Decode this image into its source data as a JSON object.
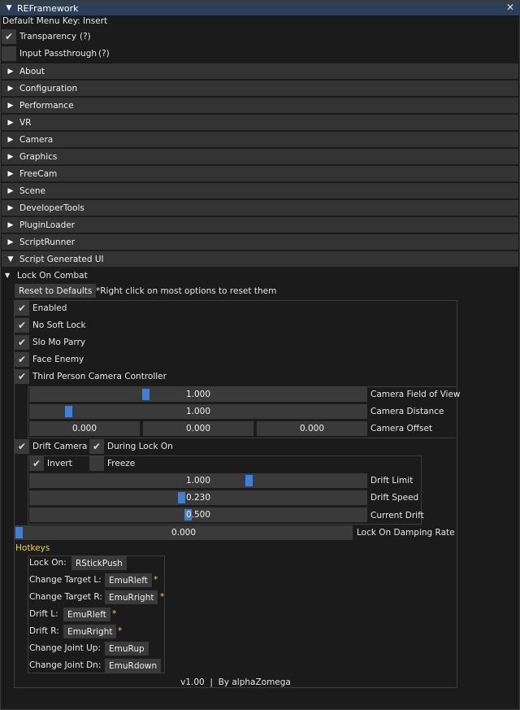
{
  "window": {
    "title": "REFramework"
  },
  "menu_key_text": "Default Menu Key: Insert",
  "options": {
    "transparency": {
      "label": "Transparency",
      "help": "(?)",
      "checked": true
    },
    "input_passthrough": {
      "label": "Input Passthrough",
      "help": "(?)",
      "checked": false
    }
  },
  "sections": [
    "About",
    "Configuration",
    "Performance",
    "VR",
    "Camera",
    "Graphics",
    "FreeCam",
    "Scene",
    "DeveloperTools",
    "PluginLoader",
    "ScriptRunner"
  ],
  "script_ui": {
    "header": "Script Generated UI",
    "lock_on_combat": {
      "title": "Lock On Combat",
      "reset_button": "Reset to Defaults",
      "reset_note": "*Right click on most options to reset them",
      "checkboxes": [
        {
          "label": "Enabled",
          "checked": true
        },
        {
          "label": "No Soft Lock",
          "checked": true
        },
        {
          "label": "Slo Mo Parry",
          "checked": true
        },
        {
          "label": "Face Enemy",
          "checked": true
        },
        {
          "label": "Third Person Camera Controller",
          "checked": true
        }
      ],
      "camera_fov": {
        "label": "Camera Field of View",
        "value": "1.000",
        "fraction": 0.34
      },
      "camera_distance": {
        "label": "Camera Distance",
        "value": "1.000",
        "fraction": 0.105
      },
      "camera_offset": {
        "label": "Camera Offset",
        "values": [
          "0.000",
          "0.000",
          "0.000"
        ]
      },
      "drift_camera": {
        "label": "Drift Camera",
        "checked": true
      },
      "during_lock_on": {
        "label": "During Lock On",
        "checked": true
      },
      "drift": {
        "invert": {
          "label": "Invert",
          "checked": true
        },
        "freeze": {
          "label": "Freeze",
          "checked": false
        },
        "limit": {
          "label": "Drift Limit",
          "value": "1.000",
          "fraction": 0.655
        },
        "speed": {
          "label": "Drift Speed",
          "value": "0.230",
          "fraction": 0.45
        },
        "current": {
          "label": "Current Drift",
          "value": "0.500",
          "fraction": 0.47
        }
      },
      "damping": {
        "label": "Lock On Damping Rate",
        "value": "0.000",
        "fraction": 0.0
      },
      "hotkeys": {
        "title": "Hotkeys",
        "items": [
          {
            "label": "Lock On:",
            "key": "RStickPush",
            "star": ""
          },
          {
            "label": "Change Target L:",
            "key": "EmuRleft",
            "star": "*"
          },
          {
            "label": "Change Target R:",
            "key": "EmuRright",
            "star": "*"
          },
          {
            "label": "Drift L:",
            "key": "EmuRleft",
            "star": "*"
          },
          {
            "label": "Drift R:",
            "key": "EmuRright",
            "star": "*"
          },
          {
            "label": "Change Joint Up:",
            "key": "EmuRup",
            "star": ""
          },
          {
            "label": "Change Joint Dn:",
            "key": "EmuRdown",
            "star": ""
          }
        ]
      },
      "footer": "v1.00  |  By alphaZomega"
    }
  },
  "colors": {
    "title_bar": "#2d3f57",
    "accent": "#3d7fd9",
    "header": "#333333",
    "hotkey_title": "#e8d44d"
  }
}
